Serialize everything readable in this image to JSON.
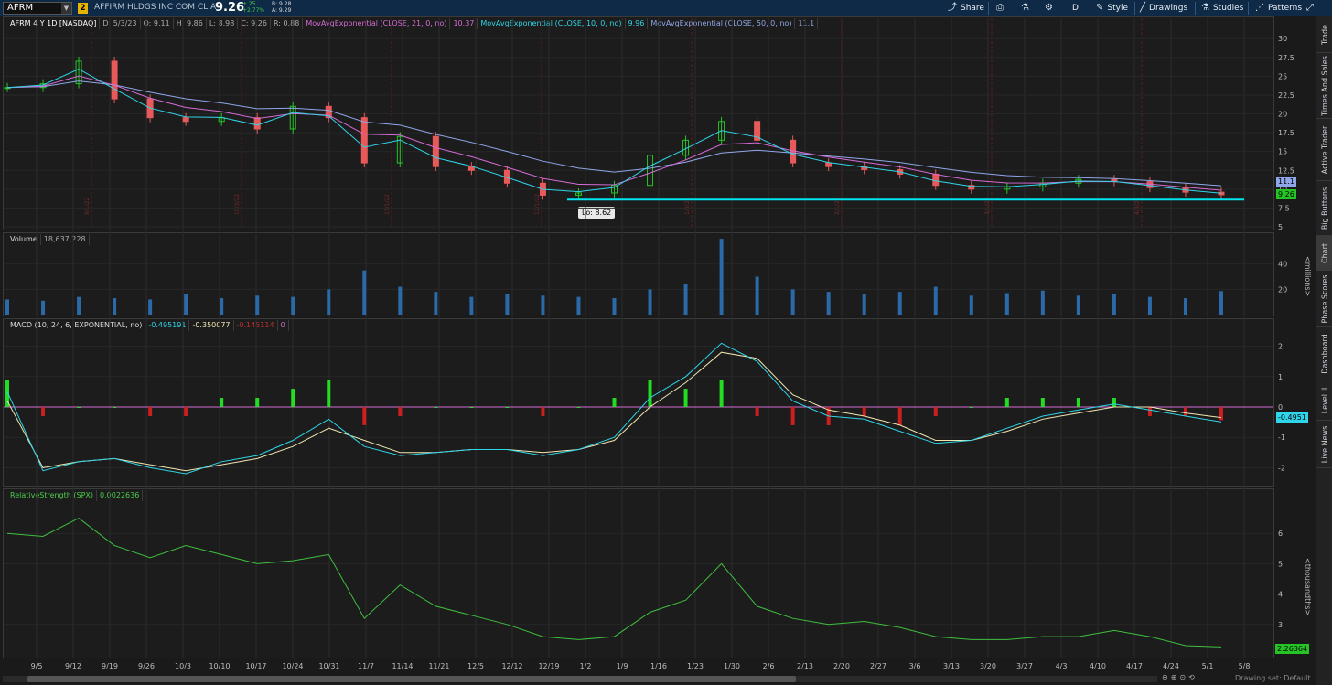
{
  "header": {
    "symbol": "AFRM",
    "link_number": "2",
    "company_name": "AFFIRM HLDGS INC COM CL A",
    "last_price": "9.26",
    "change_abs": "+.25",
    "change_pct": "+2.77%",
    "bid": "B: 9.28",
    "ask": "A: 9.29",
    "buttons": {
      "share": "Share",
      "frequency": "D",
      "style": "Style",
      "drawings": "Drawings",
      "studies": "Studies",
      "patterns": "Patterns"
    }
  },
  "right_tabs": [
    "Trade",
    "Times And Sales",
    "Active Trader",
    "Big Buttons",
    "Chart",
    "Phase Scores",
    "Dashboard",
    "Level II",
    "Live News"
  ],
  "price_panel": {
    "legend": {
      "title": "AFRM 4 Y 1D [NASDAQ]",
      "date": "D: 5/3/23",
      "open": "O: 9.11",
      "high": "H: 9.86",
      "low": "L: 8.98",
      "close": "C: 9.26",
      "range": "R: 0.88",
      "ema21_label": "MovAvgExponential (CLOSE, 21, 0, no)",
      "ema21_value": "10.37",
      "ema10_label": "MovAvgExponential (CLOSE, 10, 0, no)",
      "ema10_value": "9.96",
      "ema50_label": "MovAvgExponential (CLOSE, 50, 0, no)",
      "ema50_value": "11.1"
    },
    "y_ticks": [
      "30",
      "27.5",
      "25",
      "22.5",
      "20",
      "17.5",
      "15",
      "12.5",
      "10",
      "7.5",
      "5"
    ],
    "ema50_tag": "11.1",
    "price_tag": "9.26",
    "low_label": "Lo: 8.62",
    "support_level": 8.62,
    "vertical_date_labels": [
      "9/1/22",
      "10/3/22",
      "11/1/22",
      "12/1/22",
      "1/3/23",
      "2/1/23",
      "3/1/23",
      "4/3/23"
    ],
    "colors": {
      "up": "#25c425",
      "down": "#e85a5a",
      "ema10": "#2fd5e8",
      "ema21": "#d56bd5",
      "ema50": "#8fa6e8",
      "support": "#00e5ee"
    }
  },
  "volume_panel": {
    "legend_title": "Volume",
    "legend_value": "18,637,228",
    "y_ticks": [
      "40",
      "20"
    ],
    "unit": "<millions>"
  },
  "macd_panel": {
    "legend_title": "MACD (10, 24, 6, EXPONENTIAL, no)",
    "value": "-0.495191",
    "avg": "-0.350077",
    "diff": "-0.145114",
    "zero": "0",
    "y_ticks": [
      "2",
      "1",
      "0",
      "-1",
      "-2"
    ],
    "tag": "-0.4951"
  },
  "rs_panel": {
    "legend_title": "RelativeStrength (SPX)",
    "value": "0.0022636",
    "y_ticks": [
      "6",
      "5",
      "4",
      "3"
    ],
    "unit": "<thousandths>",
    "tag": "2.26364"
  },
  "x_ticks": [
    "9/5",
    "9/12",
    "9/19",
    "9/26",
    "10/3",
    "10/10",
    "10/17",
    "10/24",
    "10/31",
    "11/7",
    "11/14",
    "11/21",
    "12/5",
    "12/12",
    "12/19",
    "1/2",
    "1/9",
    "1/16",
    "1/23",
    "1/30",
    "2/6",
    "2/13",
    "2/20",
    "2/27",
    "3/6",
    "3/13",
    "3/20",
    "3/27",
    "4/3",
    "4/10",
    "4/17",
    "4/24",
    "5/1",
    "5/8"
  ],
  "style_setting": "Drawing set: Default",
  "chart_data": {
    "type": "line",
    "x": [
      "9/1",
      "9/5",
      "9/12",
      "9/19",
      "9/26",
      "10/3",
      "10/10",
      "10/17",
      "10/24",
      "10/31",
      "11/7",
      "11/14",
      "11/21",
      "12/5",
      "12/12",
      "12/19",
      "1/2",
      "1/9",
      "1/16",
      "1/23",
      "1/30",
      "2/6",
      "2/13",
      "2/20",
      "2/27",
      "3/6",
      "3/13",
      "3/20",
      "3/27",
      "4/3",
      "4/10",
      "4/17",
      "4/24",
      "5/1",
      "5/3"
    ],
    "series": [
      {
        "name": "AFRM",
        "values": [
          23.5,
          24.0,
          27.0,
          22.0,
          19.5,
          19.0,
          19.5,
          18.0,
          21.0,
          19.5,
          13.5,
          17.0,
          13.0,
          12.5,
          10.8,
          9.2,
          9.5,
          10.5,
          14.5,
          16.5,
          19.0,
          16.5,
          13.5,
          13.0,
          12.6,
          12.0,
          10.5,
          10.0,
          10.3,
          10.8,
          11.3,
          11.0,
          10.2,
          9.6,
          9.26
        ]
      }
    ],
    "volume_millions": [
      12,
      11,
      14,
      13,
      12,
      16,
      13,
      15,
      14,
      20,
      35,
      22,
      18,
      14,
      16,
      15,
      14,
      13,
      20,
      24,
      60,
      30,
      20,
      18,
      16,
      18,
      22,
      15,
      17,
      19,
      15,
      16,
      14,
      13,
      18.6
    ],
    "macd": [
      0.5,
      -2.1,
      -1.8,
      -1.7,
      -2.0,
      -2.2,
      -1.8,
      -1.6,
      -1.1,
      -0.4,
      -1.3,
      -1.6,
      -1.5,
      -1.4,
      -1.4,
      -1.6,
      -1.4,
      -1.0,
      0.3,
      1.0,
      2.1,
      1.5,
      0.2,
      -0.3,
      -0.4,
      -0.8,
      -1.2,
      -1.1,
      -0.7,
      -0.3,
      -0.1,
      0.1,
      -0.1,
      -0.3,
      -0.495
    ],
    "macd_avg": [
      0.2,
      -2.0,
      -1.8,
      -1.7,
      -1.9,
      -2.1,
      -1.9,
      -1.7,
      -1.3,
      -0.7,
      -1.1,
      -1.5,
      -1.5,
      -1.4,
      -1.4,
      -1.5,
      -1.4,
      -1.1,
      0.0,
      0.8,
      1.8,
      1.6,
      0.4,
      -0.1,
      -0.3,
      -0.6,
      -1.1,
      -1.1,
      -0.8,
      -0.4,
      -0.2,
      0.0,
      0.0,
      -0.2,
      -0.35
    ],
    "relative_strength": [
      6.0,
      5.9,
      6.5,
      5.6,
      5.2,
      5.6,
      5.3,
      5.0,
      5.1,
      5.3,
      3.2,
      4.3,
      3.6,
      3.3,
      3.0,
      2.6,
      2.5,
      2.6,
      3.4,
      3.8,
      5.0,
      3.6,
      3.2,
      3.0,
      3.1,
      2.9,
      2.6,
      2.5,
      2.5,
      2.6,
      2.6,
      2.8,
      2.6,
      2.3,
      2.26
    ],
    "ylim_price": [
      5,
      31
    ],
    "ylim_volume_millions": [
      0,
      55
    ],
    "ylim_macd": [
      -2.5,
      2.5
    ],
    "ylim_rs": [
      2,
      7
    ],
    "grid": true
  }
}
